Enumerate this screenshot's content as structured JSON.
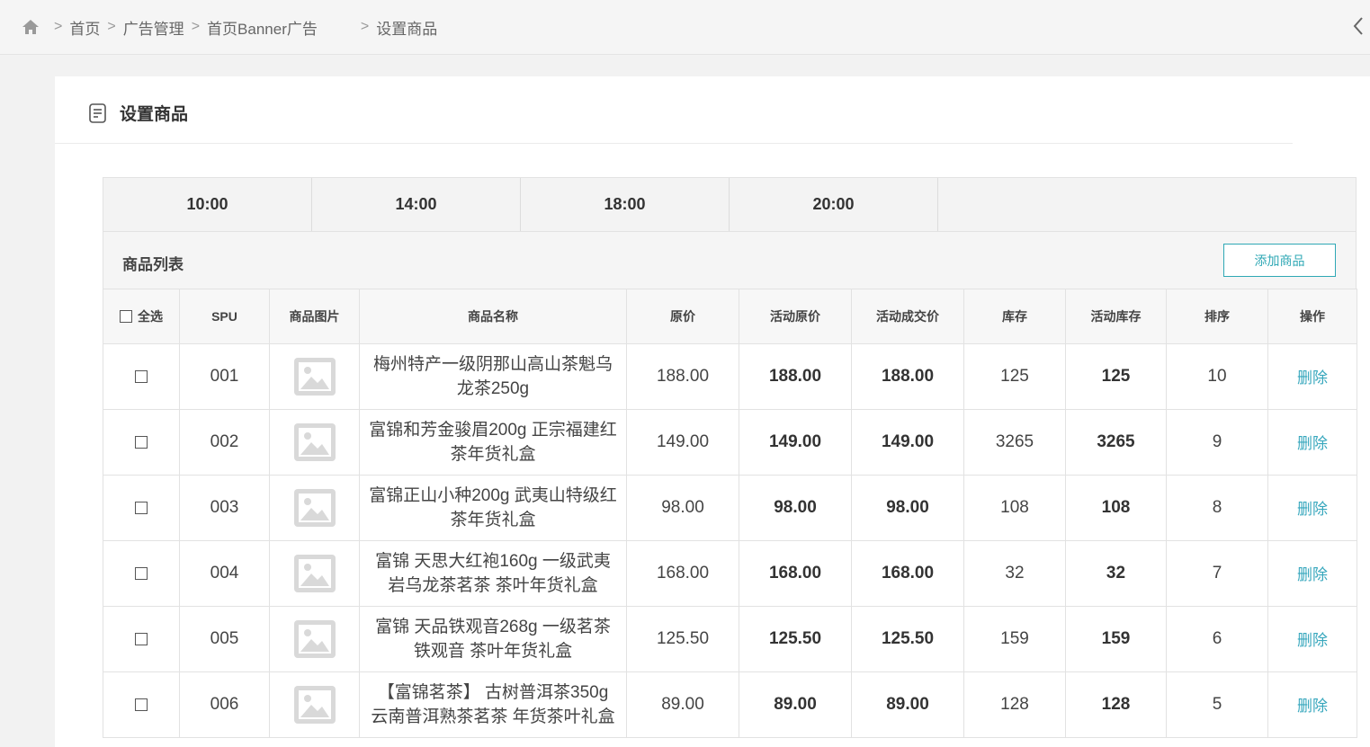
{
  "breadcrumb": {
    "home_icon": "home-icon",
    "items": [
      "首页",
      "广告管理",
      "首页Banner广告",
      "设置商品"
    ]
  },
  "panel": {
    "title": "设置商品",
    "title_icon": "document-icon"
  },
  "time_tabs": [
    "10:00",
    "14:00",
    "18:00",
    "20:00"
  ],
  "list": {
    "title": "商品列表",
    "add_button": "添加商品"
  },
  "table": {
    "select_all": "全选",
    "columns": [
      "SPU",
      "商品图片",
      "商品名称",
      "原价",
      "活动原价",
      "活动成交价",
      "库存",
      "活动库存",
      "排序",
      "操作"
    ],
    "rows": [
      {
        "spu": "001",
        "name_line1": "梅州特产一级阴那山高山茶魁乌",
        "name_line2": "龙茶250g",
        "price": "188.00",
        "act_price": "188.00",
        "deal_price": "188.00",
        "stock": "125",
        "act_stock": "125",
        "sort": "10",
        "action": "删除"
      },
      {
        "spu": "002",
        "name_line1": "富锦和芳金骏眉200g 正宗福建红",
        "name_line2": "茶年货礼盒",
        "price": "149.00",
        "act_price": "149.00",
        "deal_price": "149.00",
        "stock": "3265",
        "act_stock": "3265",
        "sort": "9",
        "action": "删除"
      },
      {
        "spu": "003",
        "name_line1": "富锦正山小种200g 武夷山特级红",
        "name_line2": "茶年货礼盒",
        "price": "98.00",
        "act_price": "98.00",
        "deal_price": "98.00",
        "stock": "108",
        "act_stock": "108",
        "sort": "8",
        "action": "删除"
      },
      {
        "spu": "004",
        "name_line1": "富锦 天思大红袍160g 一级武夷",
        "name_line2": "岩乌龙茶茗茶 茶叶年货礼盒",
        "price": "168.00",
        "act_price": "168.00",
        "deal_price": "168.00",
        "stock": "32",
        "act_stock": "32",
        "sort": "7",
        "action": "删除"
      },
      {
        "spu": "005",
        "name_line1": "富锦 天品铁观音268g 一级茗茶",
        "name_line2": "铁观音 茶叶年货礼盒",
        "price": "125.50",
        "act_price": "125.50",
        "deal_price": "125.50",
        "stock": "159",
        "act_stock": "159",
        "sort": "6",
        "action": "删除"
      },
      {
        "spu": "006",
        "name_line1": "【富锦茗茶】 古树普洱茶350g",
        "name_line2": "云南普洱熟茶茗茶 年货茶叶礼盒",
        "price": "89.00",
        "act_price": "89.00",
        "deal_price": "89.00",
        "stock": "128",
        "act_stock": "128",
        "sort": "5",
        "action": "删除"
      }
    ]
  },
  "colors": {
    "accent": "#2fa8b5",
    "link": "#37a7bd"
  }
}
